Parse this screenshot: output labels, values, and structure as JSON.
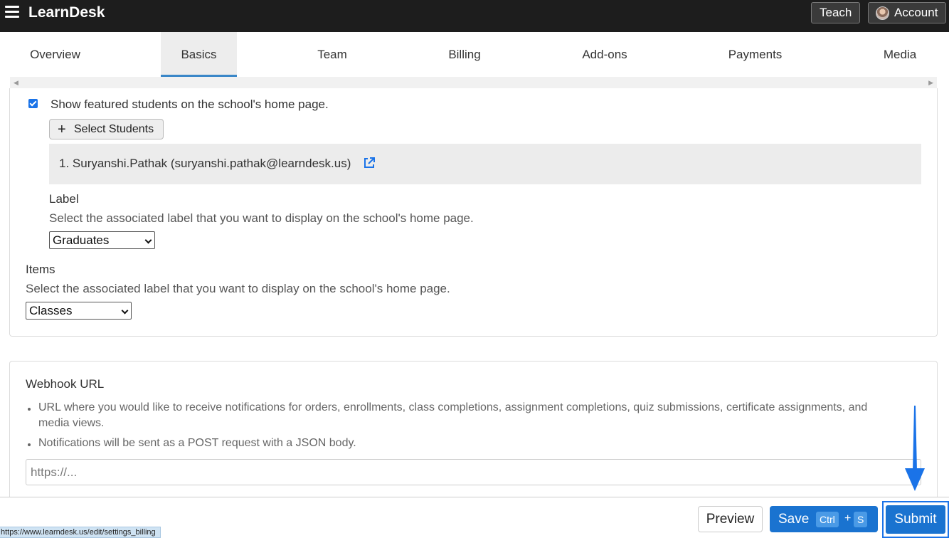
{
  "app": {
    "brand": "LearnDesk",
    "teach_label": "Teach",
    "account_label": "Account"
  },
  "tabs": [
    {
      "label": "Overview",
      "active": false
    },
    {
      "label": "Basics",
      "active": true
    },
    {
      "label": "Team",
      "active": false
    },
    {
      "label": "Billing",
      "active": false
    },
    {
      "label": "Add-ons",
      "active": false
    },
    {
      "label": "Payments",
      "active": false
    },
    {
      "label": "Media",
      "active": false
    }
  ],
  "featured": {
    "checkbox_checked": true,
    "checkbox_label": "Show featured students on the school's home page.",
    "select_students_label": "Select Students",
    "students": [
      "1. Suryanshi.Pathak (suryanshi.pathak@learndesk.us)"
    ],
    "label_heading": "Label",
    "label_help": "Select the associated label that you want to display on the school's home page.",
    "label_value": "Graduates"
  },
  "items": {
    "heading": "Items",
    "help": "Select the associated label that you want to display on the school's home page.",
    "value": "Classes"
  },
  "webhook": {
    "heading": "Webhook URL",
    "notes": [
      "URL where you would like to receive notifications for orders, enrollments, class completions, assignment completions, quiz submissions, certificate assignments, and",
      "media views.",
      "Notifications will be sent as a POST request with a JSON body."
    ],
    "placeholder": "https://..."
  },
  "footer": {
    "preview_label": "Preview",
    "save_label": "Save",
    "shortcut_ctrl": "Ctrl",
    "shortcut_plus": "+",
    "shortcut_key": "S",
    "submit_label": "Submit"
  },
  "status_url": "https://www.learndesk.us/edit/settings_billing",
  "colors": {
    "accent": "#1a73d0",
    "topbar": "#1d1d1d"
  }
}
